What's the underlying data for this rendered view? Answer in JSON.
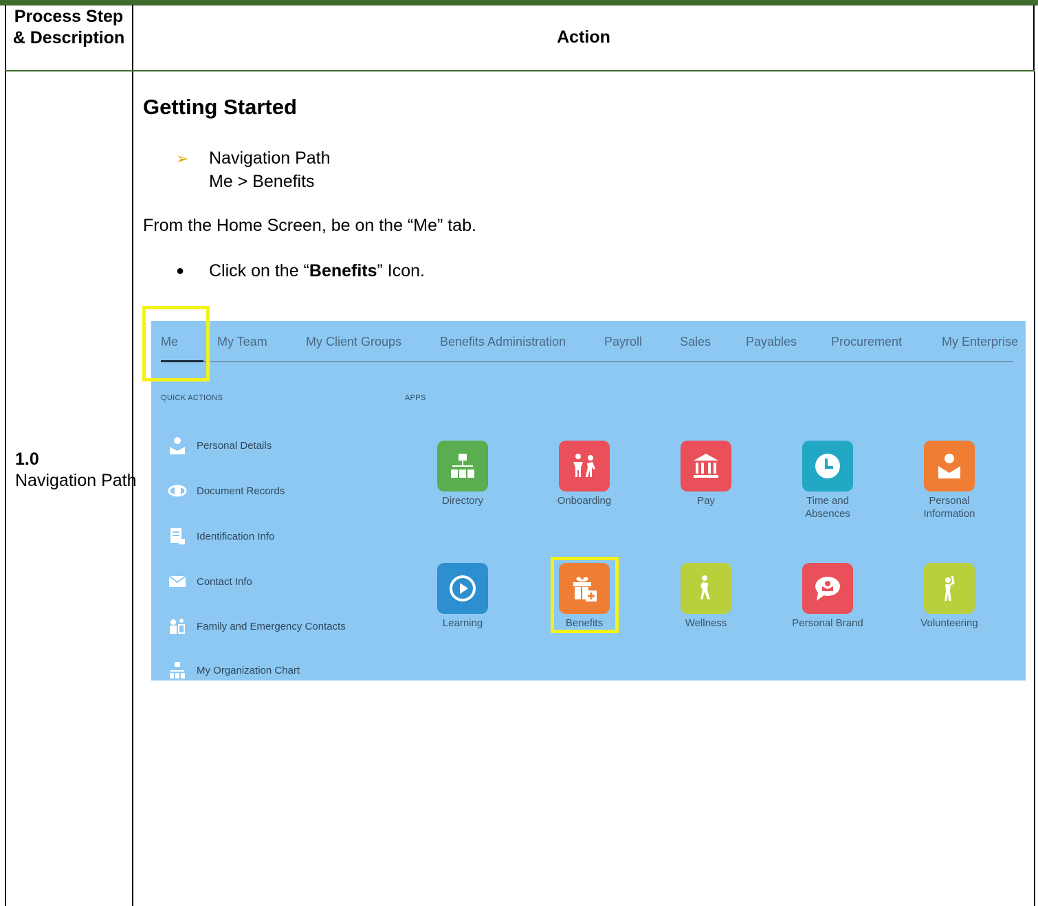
{
  "header": {
    "col1": "Process Step & Description",
    "col2": "Action"
  },
  "step": {
    "number": "1.0",
    "title": "Navigation Path"
  },
  "content": {
    "heading": "Getting Started",
    "nav_label": "Navigation Path",
    "nav_path": "Me > Benefits",
    "instruction": "From the Home Screen, be on the “Me” tab.",
    "bullet_pre": "Click on the “",
    "bullet_bold": "Benefits",
    "bullet_post": "” Icon."
  },
  "screenshot": {
    "tabs": [
      "Me",
      "My Team",
      "My Client Groups",
      "Benefits Administration",
      "Payroll",
      "Sales",
      "Payables",
      "Procurement",
      "My Enterprise"
    ],
    "active_tab": "Me",
    "quick_actions_title": "QUICK ACTIONS",
    "apps_title": "APPS",
    "quick_actions": [
      {
        "label": "Personal Details",
        "icon": "person-icon"
      },
      {
        "label": "Document Records",
        "icon": "document-records-icon"
      },
      {
        "label": "Identification Info",
        "icon": "id-card-icon"
      },
      {
        "label": "Contact Info",
        "icon": "envelope-icon"
      },
      {
        "label": "Family and Emergency Contacts",
        "icon": "family-icon"
      },
      {
        "label": "My Organization Chart",
        "icon": "org-chart-icon"
      }
    ],
    "apps": [
      {
        "label": "Directory",
        "icon": "directory-icon",
        "color": "#5aae4f"
      },
      {
        "label": "Onboarding",
        "icon": "onboarding-icon",
        "color": "#e9505a"
      },
      {
        "label": "Pay",
        "icon": "bank-icon",
        "color": "#e9505a"
      },
      {
        "label": "Time and Absences",
        "icon": "clock-icon",
        "color": "#22a8c4"
      },
      {
        "label": "Personal Information",
        "icon": "person-icon",
        "color": "#ef7d33"
      },
      {
        "label": "Learning",
        "icon": "play-icon",
        "color": "#2d8fd0"
      },
      {
        "label": "Benefits",
        "icon": "gift-icon",
        "color": "#ef7d33"
      },
      {
        "label": "Wellness",
        "icon": "wellness-icon",
        "color": "#b9cf3b"
      },
      {
        "label": "Personal Brand",
        "icon": "speech-bubble-icon",
        "color": "#e9505a"
      },
      {
        "label": "Volunteering",
        "icon": "volunteer-icon",
        "color": "#b9cf3b"
      }
    ],
    "highlight_color": "#f2f21a"
  }
}
